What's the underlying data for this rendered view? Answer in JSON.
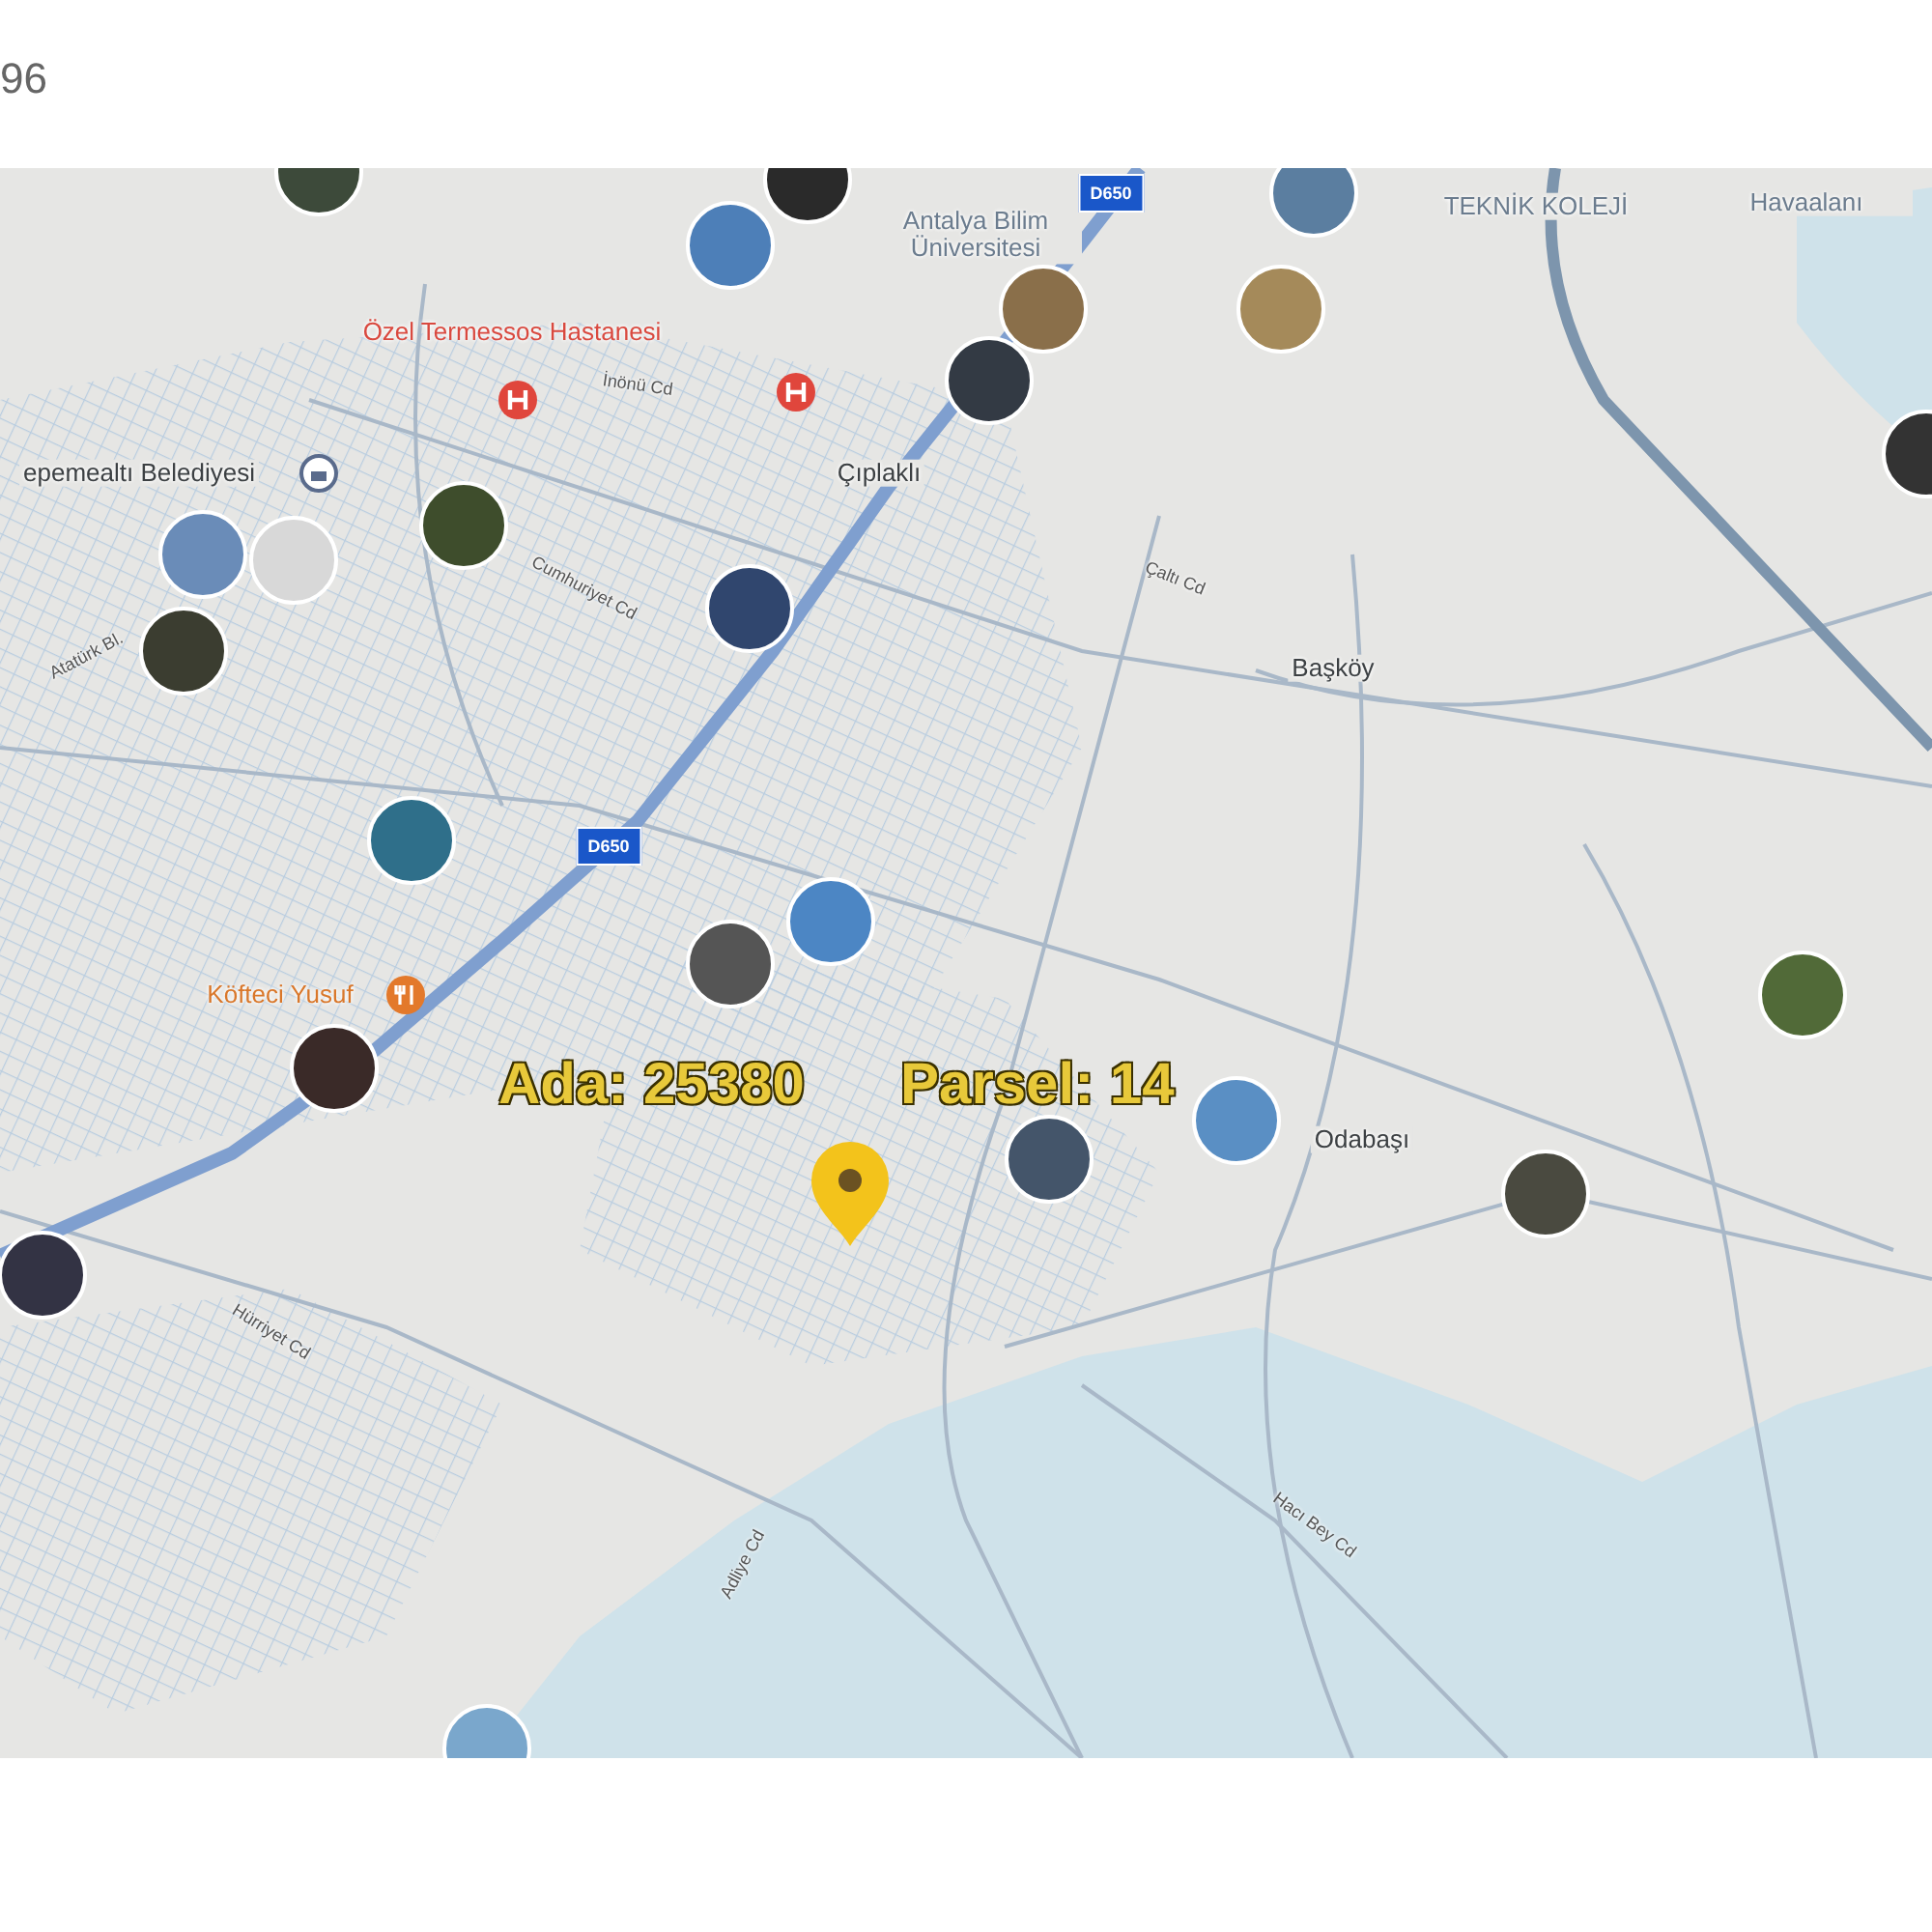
{
  "header": {
    "count": "96"
  },
  "map": {
    "labels": [
      {
        "kind": "poi",
        "text": "Özel Termessos Hastanesi"
      },
      {
        "kind": "road",
        "text": "İnönü Cd"
      },
      {
        "kind": "place",
        "text": "epemealtı Belediyesi"
      },
      {
        "kind": "place",
        "text": "Çıplaklı"
      },
      {
        "kind": "campus",
        "text": "Antalya Bilim Üniversitesi"
      },
      {
        "kind": "campus",
        "text": "TEKNİK KOLEJİ"
      },
      {
        "kind": "campus",
        "text": "Havaalanı"
      },
      {
        "kind": "road",
        "text": "Çaltı Cd"
      },
      {
        "kind": "place",
        "text": "Başköy"
      },
      {
        "kind": "road",
        "text": "Cumhuriyet Cd"
      },
      {
        "kind": "road",
        "text": "Atatürk Bl."
      },
      {
        "kind": "food",
        "text": "Köfteci Yusuf"
      },
      {
        "kind": "place",
        "text": "Odabaşı"
      },
      {
        "kind": "road",
        "text": "Hürriyet Cd"
      },
      {
        "kind": "road",
        "text": "Adliye Cd"
      },
      {
        "kind": "road",
        "text": "Hacı Bey Cd"
      }
    ],
    "shields": [
      "D650",
      "D650"
    ],
    "parcel": {
      "block": "Ada: 25380",
      "plot": "Parsel: 14"
    }
  }
}
